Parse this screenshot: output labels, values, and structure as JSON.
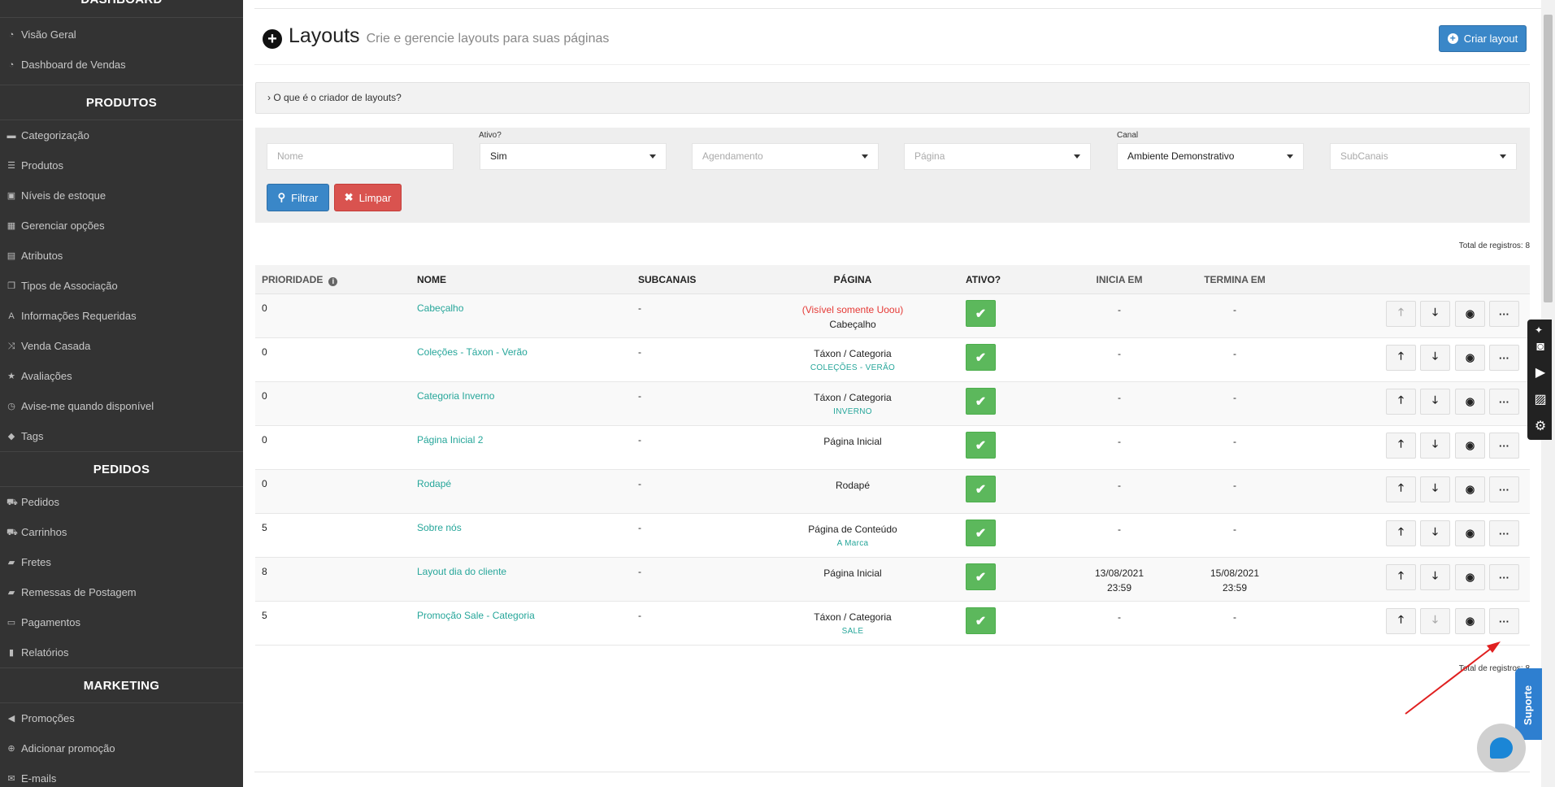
{
  "sidebar": {
    "section_dashboard": "DASHBOARD",
    "dashboard_items": [
      {
        "icon": "dashboard-icon",
        "label": "Visão Geral"
      },
      {
        "icon": "dashboard-icon",
        "label": "Dashboard de Vendas"
      }
    ],
    "section_produtos": "PRODUTOS",
    "produtos_items": [
      {
        "icon": "folder-icon",
        "label": "Categorização"
      },
      {
        "icon": "list-icon",
        "label": "Produtos"
      },
      {
        "icon": "cubes-icon",
        "label": "Níveis de estoque"
      },
      {
        "icon": "grid-icon",
        "label": "Gerenciar opções"
      },
      {
        "icon": "list-alt-icon",
        "label": "Atributos"
      },
      {
        "icon": "clone-icon",
        "label": "Tipos de Associação"
      },
      {
        "icon": "font-icon",
        "label": "Informações Requeridas"
      },
      {
        "icon": "random-icon",
        "label": "Venda Casada"
      },
      {
        "icon": "star-icon",
        "label": "Avaliações"
      },
      {
        "icon": "clock-icon",
        "label": "Avise-me quando disponível"
      },
      {
        "icon": "tag-icon",
        "label": "Tags"
      }
    ],
    "section_pedidos": "PEDIDOS",
    "pedidos_items": [
      {
        "icon": "cart-icon",
        "label": "Pedidos"
      },
      {
        "icon": "cart-icon",
        "label": "Carrinhos"
      },
      {
        "icon": "truck-icon",
        "label": "Fretes"
      },
      {
        "icon": "truck-icon",
        "label": "Remessas de Postagem"
      },
      {
        "icon": "credit-card-icon",
        "label": "Pagamentos"
      },
      {
        "icon": "bar-chart-icon",
        "label": "Relatórios"
      }
    ],
    "section_marketing": "MARKETING",
    "marketing_items": [
      {
        "icon": "bullhorn-icon",
        "label": "Promoções"
      },
      {
        "icon": "plus-circle-icon",
        "label": "Adicionar promoção"
      },
      {
        "icon": "envelope-icon",
        "label": "E-mails"
      }
    ]
  },
  "header": {
    "title": "Layouts",
    "subtitle": "Crie e gerencie layouts para suas páginas",
    "create_button": "Criar layout"
  },
  "collapse": {
    "label": "› O que é o criador de layouts?"
  },
  "filters": {
    "nome_placeholder": "Nome",
    "ativo_label": "Ativo?",
    "ativo_value": "Sim",
    "agendamento_placeholder": "Agendamento",
    "pagina_placeholder": "Página",
    "canal_label": "Canal",
    "canal_value": "Ambiente Demonstrativo",
    "subcanais_placeholder": "SubCanais",
    "filter_button": "Filtrar",
    "clear_button": "Limpar"
  },
  "total_top": "Total de registros: 8",
  "total_bottom": "Total de registros: 8",
  "table": {
    "headers": {
      "prioridade": "PRIORIDADE",
      "nome": "NOME",
      "subcanais": "SUBCANAIS",
      "pagina": "PÁGINA",
      "ativo": "ATIVO?",
      "inicia": "INICIA EM",
      "termina": "TERMINA EM"
    },
    "rows": [
      {
        "prioridade": "0",
        "nome": "Cabeçalho",
        "subcanais": "-",
        "pagina_note": "(Visível somente Uoou)",
        "pagina": "Cabeçalho",
        "pagina_sub": "",
        "inicia_date": "-",
        "inicia_time": "",
        "termina_date": "-",
        "termina_time": ""
      },
      {
        "prioridade": "0",
        "nome": "Coleções - Táxon - Verão",
        "subcanais": "-",
        "pagina_note": "",
        "pagina": "Táxon / Categoria",
        "pagina_sub": "COLEÇÕES - VERÃO",
        "inicia_date": "-",
        "inicia_time": "",
        "termina_date": "-",
        "termina_time": ""
      },
      {
        "prioridade": "0",
        "nome": "Categoria Inverno",
        "subcanais": "-",
        "pagina_note": "",
        "pagina": "Táxon / Categoria",
        "pagina_sub": "INVERNO",
        "inicia_date": "-",
        "inicia_time": "",
        "termina_date": "-",
        "termina_time": ""
      },
      {
        "prioridade": "0",
        "nome": "Página Inicial 2",
        "subcanais": "-",
        "pagina_note": "",
        "pagina": "Página Inicial",
        "pagina_sub": "",
        "inicia_date": "-",
        "inicia_time": "",
        "termina_date": "-",
        "termina_time": ""
      },
      {
        "prioridade": "0",
        "nome": "Rodapé",
        "subcanais": "-",
        "pagina_note": "",
        "pagina": "Rodapé",
        "pagina_sub": "",
        "inicia_date": "-",
        "inicia_time": "",
        "termina_date": "-",
        "termina_time": ""
      },
      {
        "prioridade": "5",
        "nome": "Sobre nós",
        "subcanais": "-",
        "pagina_note": "",
        "pagina": "Página de Conteúdo",
        "pagina_sub": "A Marca",
        "inicia_date": "-",
        "inicia_time": "",
        "termina_date": "-",
        "termina_time": ""
      },
      {
        "prioridade": "8",
        "nome": "Layout dia do cliente",
        "subcanais": "-",
        "pagina_note": "",
        "pagina": "Página Inicial",
        "pagina_sub": "",
        "inicia_date": "13/08/2021",
        "inicia_time": "23:59",
        "termina_date": "15/08/2021",
        "termina_time": "23:59"
      },
      {
        "prioridade": "5",
        "nome": "Promoção Sale - Categoria",
        "subcanais": "-",
        "pagina_note": "",
        "pagina": "Táxon / Categoria",
        "pagina_sub": "SALE",
        "inicia_date": "-",
        "inicia_time": "",
        "termina_date": "-",
        "termina_time": ""
      }
    ]
  },
  "support": {
    "label": "Suporte"
  },
  "colors": {
    "sidebar_bg": "#333333",
    "primary": "#3a87c8",
    "danger": "#d9534f",
    "success": "#5cb85c",
    "link": "#26a69a",
    "warning_text": "#e53935"
  }
}
